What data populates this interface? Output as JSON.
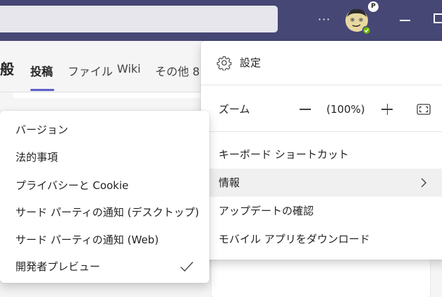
{
  "titlebar": {
    "more_label": "···",
    "avatar_badge": "P",
    "status_color": "#6bb700",
    "bg_color": "#464775"
  },
  "channel": {
    "title": "般",
    "tabs": [
      {
        "label": "投稿",
        "active": true
      },
      {
        "label": "ファイル",
        "active": false
      },
      {
        "label": "Wiki",
        "active": false
      },
      {
        "label": "その他 8",
        "active": false
      }
    ],
    "accent": "#5b5fc7"
  },
  "menu": {
    "settings": {
      "label": "設定",
      "icon": "gear-icon"
    },
    "zoom": {
      "label": "ズーム",
      "value": "(100%)",
      "minus_icon": "minus-icon",
      "plus_icon": "plus-icon",
      "fullscreen_icon": "fullscreen-icon"
    },
    "items": [
      {
        "label": "キーボード ショートカット"
      },
      {
        "label": "情報",
        "has_submenu": true
      },
      {
        "label": "アップデートの確認"
      },
      {
        "label": "モバイル アプリをダウンロード"
      }
    ]
  },
  "submenu": {
    "items": [
      {
        "label": "バージョン"
      },
      {
        "label": "法的事項"
      },
      {
        "label": "プライバシーと Cookie"
      },
      {
        "label": "サード パーティの通知 (デスクトップ)"
      },
      {
        "label": "サード パーティの通知 (Web)"
      },
      {
        "label": "開発者プレビュー",
        "checked": true
      }
    ]
  }
}
